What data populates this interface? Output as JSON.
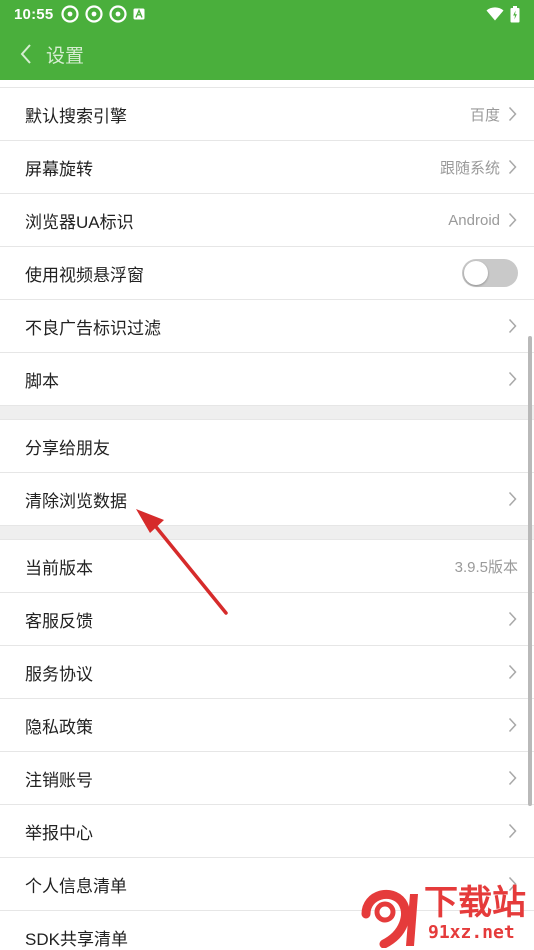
{
  "status_bar": {
    "time": "10:55",
    "icons_left": [
      "app-notification-icon",
      "app-notification-icon",
      "app-notification-icon",
      "a-badge-icon"
    ],
    "icons_right": [
      "wifi-icon",
      "battery-icon"
    ]
  },
  "header": {
    "title": "设置",
    "back_icon": "chevron-left-icon",
    "background_color": "#4aaf3c"
  },
  "section1": [
    {
      "label": "默认搜索引擎",
      "value": "百度",
      "chevron": true
    },
    {
      "label": "屏幕旋转",
      "value": "跟随系统",
      "chevron": true
    },
    {
      "label": "浏览器UA标识",
      "value": "Android",
      "chevron": true
    },
    {
      "label": "使用视频悬浮窗",
      "toggle": false
    },
    {
      "label": "不良广告标识过滤",
      "chevron": true
    },
    {
      "label": "脚本",
      "chevron": true
    }
  ],
  "section2": [
    {
      "label": "分享给朋友"
    },
    {
      "label": "清除浏览数据",
      "chevron": true
    }
  ],
  "section3": [
    {
      "label": "当前版本",
      "value": "3.9.5版本"
    },
    {
      "label": "客服反馈",
      "chevron": true
    },
    {
      "label": "服务协议",
      "chevron": true
    },
    {
      "label": "隐私政策",
      "chevron": true
    },
    {
      "label": "注销账号",
      "chevron": true
    },
    {
      "label": "举报中心",
      "chevron": true
    },
    {
      "label": "个人信息清单",
      "chevron": true
    },
    {
      "label": "SDK共享清单"
    }
  ],
  "watermark": {
    "text": "下载站",
    "url": "91xz.net",
    "accent_color": "#e53b3b"
  }
}
